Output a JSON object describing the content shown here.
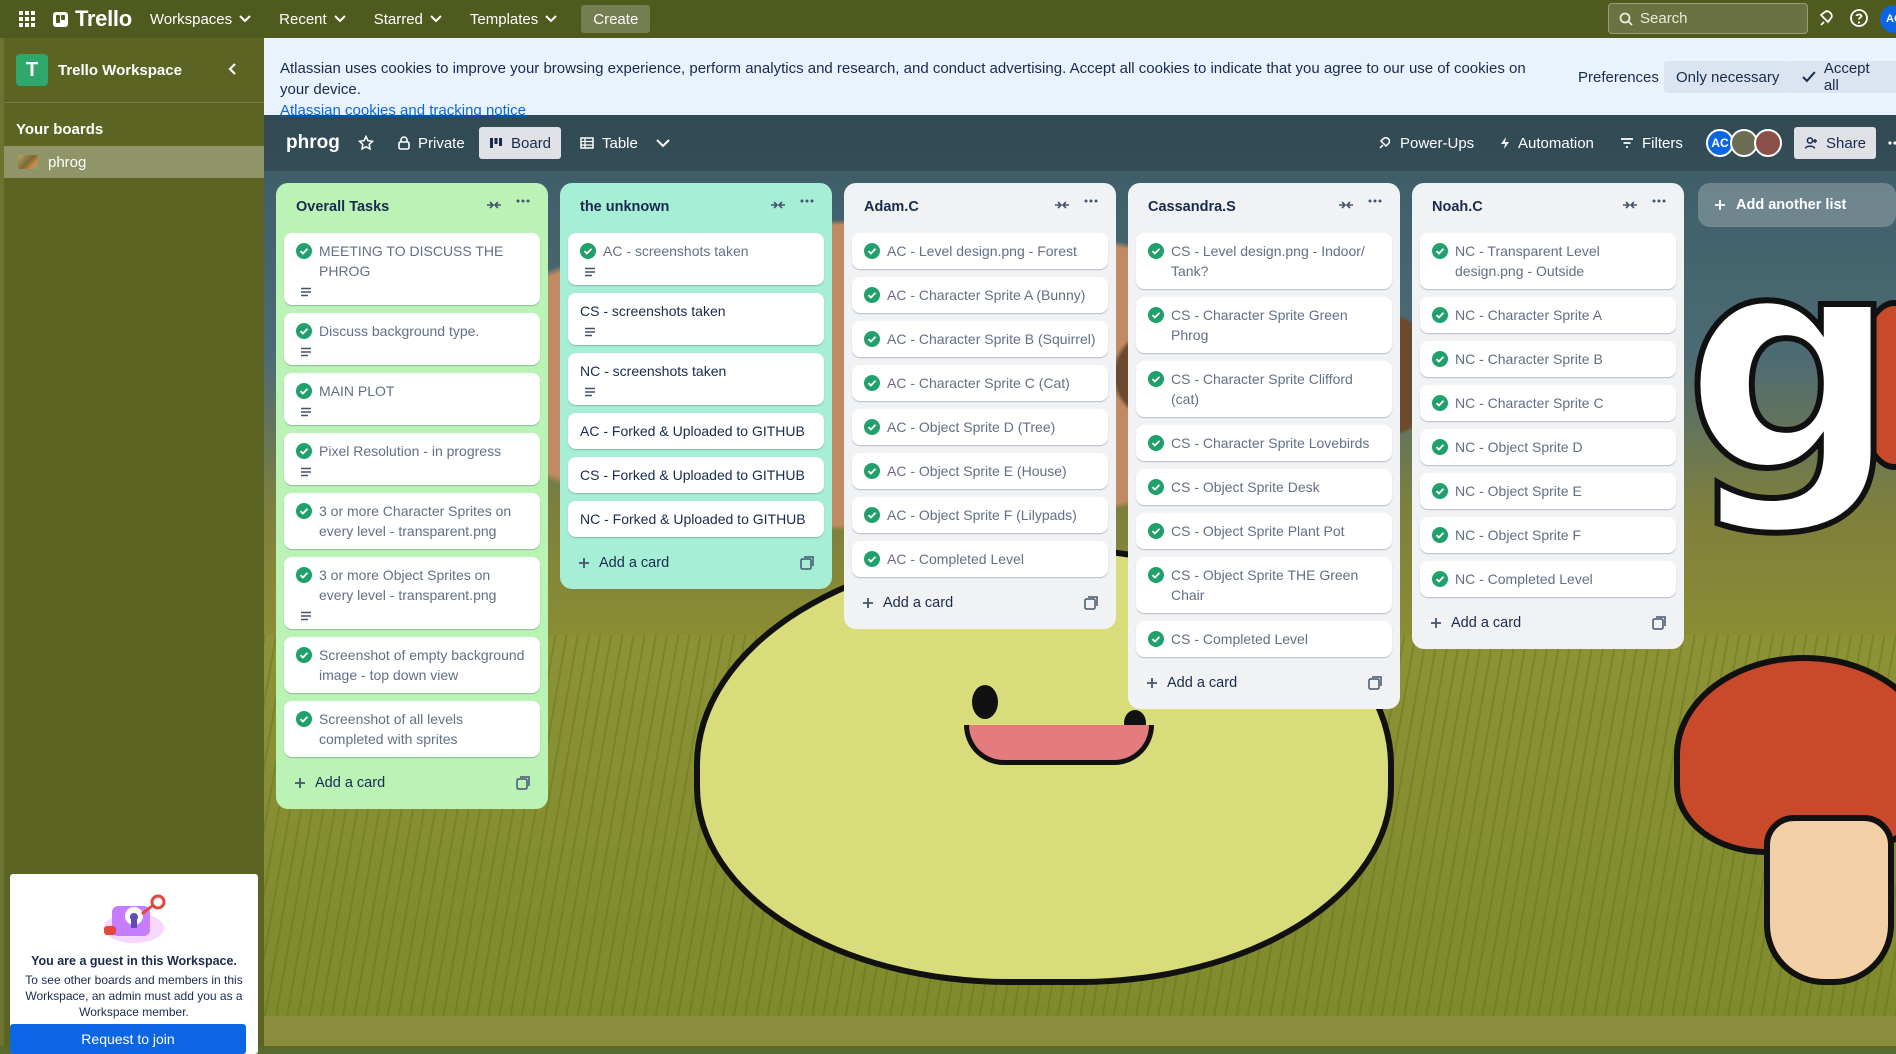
{
  "topbar": {
    "app_name": "Trello",
    "menus": [
      {
        "label": "Workspaces"
      },
      {
        "label": "Recent"
      },
      {
        "label": "Starred"
      },
      {
        "label": "Templates"
      }
    ],
    "create_label": "Create",
    "search_placeholder": "Search",
    "user_initials": "AC"
  },
  "sidebar": {
    "workspace_initial": "T",
    "workspace_name": "Trello Workspace",
    "section_title": "Your boards",
    "boards": [
      {
        "label": "phrog"
      }
    ],
    "guest_title": "You are a guest in this Workspace.",
    "guest_text": "To see other boards and members in this Workspace, an admin must add you as a Workspace member.",
    "guest_button": "Request to join"
  },
  "cookie_banner": {
    "text": "Atlassian uses cookies to improve your browsing experience, perform analytics and research, and conduct advertising. Accept all cookies to indicate that you agree to our use of cookies on your device.",
    "link": "Atlassian cookies and tracking notice",
    "preferences": "Preferences",
    "only_necessary": "Only necessary",
    "accept_all": "Accept all"
  },
  "board_header": {
    "title": "phrog",
    "visibility": "Private",
    "view_board": "Board",
    "view_table": "Table",
    "power_ups": "Power-Ups",
    "automation": "Automation",
    "filters": "Filters",
    "member_initials": "AC",
    "share": "Share"
  },
  "lists": [
    {
      "title": "Overall Tasks",
      "color": "#baf3b5",
      "cards": [
        {
          "text": "MEETING TO DISCUSS THE PHROG",
          "done": true,
          "desc": true
        },
        {
          "text": "Discuss background type.",
          "done": true,
          "desc": true
        },
        {
          "text": "MAIN PLOT",
          "done": true,
          "desc": true
        },
        {
          "text": "Pixel Resolution - in progress",
          "done": true,
          "desc": true
        },
        {
          "text": "3 or more Character Sprites on every level - transparent.png",
          "done": true,
          "desc": false
        },
        {
          "text": "3 or more Object Sprites on every level - transparent.png",
          "done": true,
          "desc": true
        },
        {
          "text": "Screenshot of empty background image - top down view",
          "done": true,
          "desc": false
        },
        {
          "text": "Screenshot of all levels completed with sprites",
          "done": true,
          "desc": false
        }
      ],
      "add_label": "Add a card"
    },
    {
      "title": "the unknown",
      "color": "#a7eed6",
      "cards": [
        {
          "text": "AC - screenshots taken",
          "done": true,
          "desc": true
        },
        {
          "text": "CS - screenshots taken",
          "done": false,
          "desc": true
        },
        {
          "text": "NC - screenshots taken",
          "done": false,
          "desc": true
        },
        {
          "text": "AC - Forked & Uploaded to GITHUB",
          "done": false,
          "desc": false
        },
        {
          "text": "CS - Forked & Uploaded to GITHUB",
          "done": false,
          "desc": false
        },
        {
          "text": "NC - Forked & Uploaded to GITHUB",
          "done": false,
          "desc": false
        }
      ],
      "add_label": "Add a card"
    },
    {
      "title": "Adam.C",
      "color": "#f1f2f4",
      "cards": [
        {
          "text": "AC - Level design.png - Forest",
          "done": true,
          "desc": false
        },
        {
          "text": "AC - Character Sprite A (Bunny)",
          "done": true,
          "desc": false
        },
        {
          "text": "AC - Character Sprite B (Squirrel)",
          "done": true,
          "desc": false
        },
        {
          "text": "AC - Character Sprite C (Cat)",
          "done": true,
          "desc": false
        },
        {
          "text": "AC - Object Sprite D (Tree)",
          "done": true,
          "desc": false
        },
        {
          "text": "AC - Object Sprite E (House)",
          "done": true,
          "desc": false
        },
        {
          "text": "AC - Object Sprite F (Lilypads)",
          "done": true,
          "desc": false
        },
        {
          "text": "AC - Completed Level",
          "done": true,
          "desc": false
        }
      ],
      "add_label": "Add a card"
    },
    {
      "title": "Cassandra.S",
      "color": "#f1f2f4",
      "cards": [
        {
          "text": "CS - Level design.png - Indoor/ Tank?",
          "done": true,
          "desc": false
        },
        {
          "text": "CS - Character Sprite Green Phrog",
          "done": true,
          "desc": false
        },
        {
          "text": "CS - Character Sprite Clifford (cat)",
          "done": true,
          "desc": false
        },
        {
          "text": "CS - Character Sprite Lovebirds",
          "done": true,
          "desc": false
        },
        {
          "text": "CS - Object Sprite Desk",
          "done": true,
          "desc": false
        },
        {
          "text": "CS - Object Sprite Plant Pot",
          "done": true,
          "desc": false
        },
        {
          "text": "CS - Object Sprite THE Green Chair",
          "done": true,
          "desc": false
        },
        {
          "text": "CS - Completed Level",
          "done": true,
          "desc": false
        }
      ],
      "add_label": "Add a card"
    },
    {
      "title": "Noah.C",
      "color": "#f1f2f4",
      "cards": [
        {
          "text": "NC - Transparent Level design.png - Outside",
          "done": true,
          "desc": false
        },
        {
          "text": "NC - Character Sprite A",
          "done": true,
          "desc": false
        },
        {
          "text": "NC - Character Sprite B",
          "done": true,
          "desc": false
        },
        {
          "text": "NC - Character Sprite C",
          "done": true,
          "desc": false
        },
        {
          "text": "NC - Object Sprite D",
          "done": true,
          "desc": false
        },
        {
          "text": "NC - Object Sprite E",
          "done": true,
          "desc": false
        },
        {
          "text": "NC - Object Sprite F",
          "done": true,
          "desc": false
        },
        {
          "text": "NC - Completed Level",
          "done": true,
          "desc": false
        }
      ],
      "add_label": "Add a card"
    }
  ],
  "add_list_label": "Add another list",
  "colors": {
    "topbar": "#4f5a1f",
    "sidebar": "#5b6423",
    "check_green": "#22a06b",
    "primary_blue": "#0c66e4"
  }
}
